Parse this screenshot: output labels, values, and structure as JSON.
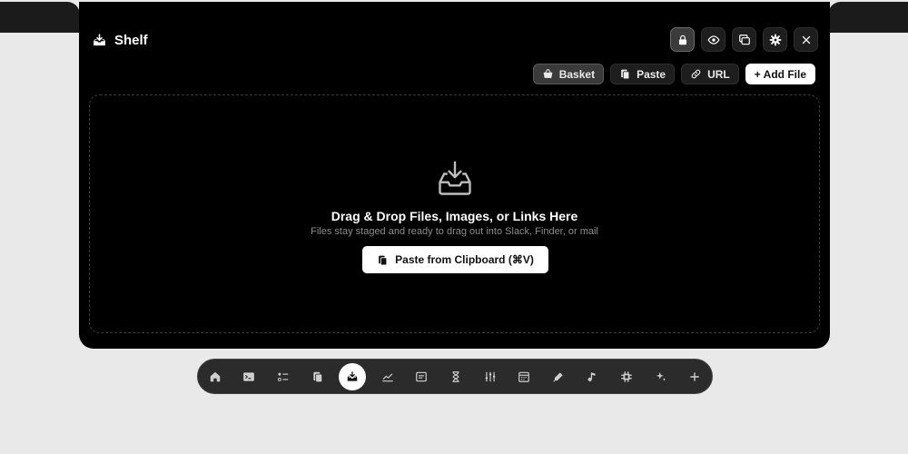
{
  "app": {
    "title": "Shelf"
  },
  "controls": [
    {
      "name": "lock-button",
      "icon": "lock-icon",
      "active": true
    },
    {
      "name": "preview-button",
      "icon": "eye-icon",
      "active": false
    },
    {
      "name": "windows-button",
      "icon": "windows-icon",
      "active": false
    },
    {
      "name": "settings-button",
      "icon": "gear-icon",
      "active": false
    },
    {
      "name": "close-button",
      "icon": "close-icon",
      "active": false
    }
  ],
  "actions": {
    "basket": "Basket",
    "paste": "Paste",
    "url": "URL",
    "add_file": "+ Add File"
  },
  "dropzone": {
    "title": "Drag & Drop Files, Images, or Links Here",
    "subtitle": "Files stay staged and ready to drag out into Slack, Finder, or mail",
    "paste_button": "Paste from Clipboard (⌘V)"
  },
  "dock": {
    "items": [
      "home-icon",
      "terminal-icon",
      "checklist-icon",
      "clipboard-icon",
      "shelf-icon",
      "chart-icon",
      "notes-icon",
      "timer-icon",
      "mixer-icon",
      "calendar-icon",
      "color-picker-icon",
      "music-icon",
      "cpu-icon",
      "sparkle-icon",
      "plus-icon"
    ],
    "active": "shelf-icon"
  }
}
